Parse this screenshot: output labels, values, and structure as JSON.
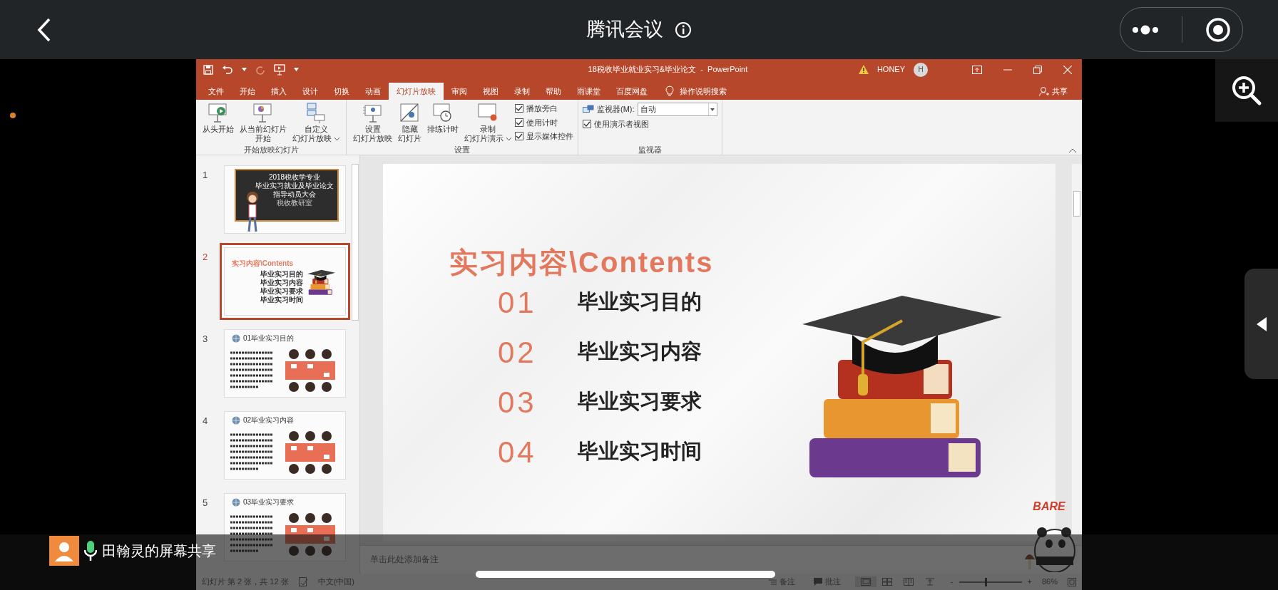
{
  "meeting": {
    "title": "腾讯会议"
  },
  "ppt": {
    "window_title": "18税收毕业就业实习&毕业论文  -  PowerPoint",
    "user": "HONEY",
    "avatar": "H",
    "tabs": [
      {
        "label": "文件",
        "selected": false
      },
      {
        "label": "开始",
        "selected": false
      },
      {
        "label": "插入",
        "selected": false
      },
      {
        "label": "设计",
        "selected": false
      },
      {
        "label": "切换",
        "selected": false
      },
      {
        "label": "动画",
        "selected": false
      },
      {
        "label": "幻灯片放映",
        "selected": true
      },
      {
        "label": "审阅",
        "selected": false
      },
      {
        "label": "视图",
        "selected": false
      },
      {
        "label": "录制",
        "selected": false
      },
      {
        "label": "帮助",
        "selected": false
      },
      {
        "label": "雨课堂",
        "selected": false
      },
      {
        "label": "百度网盘",
        "selected": false
      }
    ],
    "tell_me": "操作说明搜索",
    "share": "共享",
    "ribbon": [
      {
        "label": "开始放映幻灯片",
        "items": [
          {
            "kind": "big",
            "lines": [
              "从头开始"
            ],
            "dropdown": false
          },
          {
            "kind": "big",
            "lines": [
              "从当前幻灯片",
              "开始"
            ],
            "dropdown": false
          },
          {
            "kind": "big",
            "lines": [
              "自定义",
              "幻灯片放映"
            ],
            "dropdown": true
          }
        ]
      },
      {
        "label": "设置",
        "items": [
          {
            "kind": "big",
            "lines": [
              "设置",
              "幻灯片放映"
            ],
            "dropdown": false
          },
          {
            "kind": "big",
            "lines": [
              "隐藏",
              "幻灯片"
            ],
            "dropdown": false
          },
          {
            "kind": "big",
            "lines": [
              "排练计时"
            ],
            "dropdown": false
          },
          {
            "kind": "big",
            "lines": [
              "录制",
              "幻灯片演示"
            ],
            "dropdown": true
          },
          {
            "kind": "check",
            "label": "播放旁白",
            "checked": true
          },
          {
            "kind": "check",
            "label": "使用计时",
            "checked": true
          },
          {
            "kind": "check",
            "label": "显示媒体控件",
            "checked": true
          }
        ]
      },
      {
        "label": "监视器",
        "items": [
          {
            "kind": "select",
            "label": "监视器(M):",
            "value": "自动"
          },
          {
            "kind": "check",
            "label": "使用演示者视图",
            "checked": true
          }
        ]
      }
    ],
    "slides": [
      {
        "number": "1",
        "selected": false,
        "kind": "cover",
        "lines": [
          "2018税收学专业",
          "毕业实习就业及毕业论文",
          "指导动员大会",
          "税收教研室"
        ]
      },
      {
        "number": "2",
        "selected": true,
        "kind": "contents",
        "lines": [
          "实习内容\\Contents",
          "毕业实习目的",
          "毕业实习内容",
          "毕业实习要求",
          "毕业实习时间"
        ]
      },
      {
        "number": "3",
        "selected": false,
        "kind": "section",
        "lines": [
          "01毕业实习目的"
        ]
      },
      {
        "number": "4",
        "selected": false,
        "kind": "section",
        "lines": [
          "02毕业实习内容"
        ]
      },
      {
        "number": "5",
        "selected": false,
        "kind": "section",
        "lines": [
          "03毕业实习要求"
        ]
      }
    ],
    "slide": {
      "title": "实习内容\\Contents",
      "items": [
        {
          "number": "01",
          "text": "毕业实习目的"
        },
        {
          "number": "02",
          "text": "毕业实习内容"
        },
        {
          "number": "03",
          "text": "毕业实习要求"
        },
        {
          "number": "04",
          "text": "毕业实习时间"
        }
      ]
    },
    "sticker": "BARE",
    "notes_placeholder": "单击此处添加备注",
    "status": {
      "slide_info": "幻灯片 第 2 张，共 12 张",
      "language": "中文(中国)",
      "notes": "备注",
      "comments": "批注",
      "views": [
        {
          "selected": true
        },
        {
          "selected": false
        },
        {
          "selected": false
        },
        {
          "selected": false
        }
      ],
      "zoom_out": "-",
      "zoom": {
        "level": 0.42
      },
      "zoom_in": "+",
      "zoom_percent": "86%"
    }
  },
  "share_banner": {
    "text": "田翰灵的屏幕共享"
  }
}
